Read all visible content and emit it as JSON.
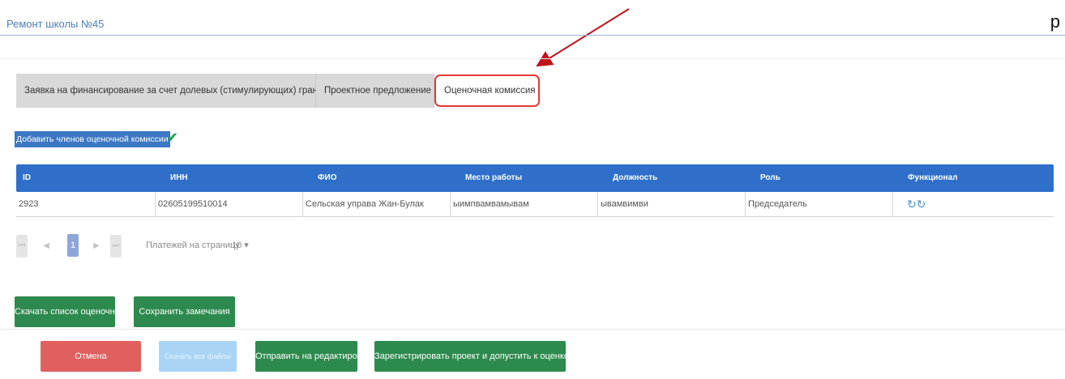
{
  "page": {
    "title": "Ремонт школы №45",
    "corner_glyph": "р"
  },
  "tabs": [
    {
      "label": "Заявка на финансирование за счет долевых (стимулирующих) грантов",
      "active": false
    },
    {
      "label": "Проектное предложение",
      "active": false
    },
    {
      "label": "Оценочная комиссия",
      "active": true
    }
  ],
  "commission": {
    "add_button": "Добавить членов оценочной комиссии"
  },
  "table": {
    "headers": [
      "ID",
      "ИНН",
      "ФИО",
      "Место работы",
      "Должность",
      "Роль",
      "Функционал"
    ],
    "rows": [
      {
        "id": "2923",
        "inn": "02605199510014",
        "fio": "Сельская управа Жан-Булак",
        "workplace": "ыимпвамвамывам",
        "position": "ывамвимви",
        "role": "Председатель",
        "actions": [
          "refresh-icon",
          "refresh-icon"
        ]
      }
    ]
  },
  "pagination": {
    "first": "⏮",
    "prev": "◀",
    "current": "1",
    "next": "▶",
    "last": "⏭",
    "per_page_label": "Платежей на страницу",
    "per_page_value": "10 ▾"
  },
  "actions": {
    "download_list": "Скачать список оценочной комиссии",
    "save_remarks": "Сохранить замечания"
  },
  "footer": {
    "cancel": "Отмена",
    "download_all": "Скачать все файлы",
    "send_to_edit": "Отправить на редактирование",
    "register": "Зарегистрировать проект и допустить к оценке"
  },
  "colors": {
    "accent": "#2f6fc9",
    "active_tab_border": "#e53935",
    "arrow": "#c0141c",
    "green": "#2d8a4e",
    "cancel": "#e06060"
  }
}
